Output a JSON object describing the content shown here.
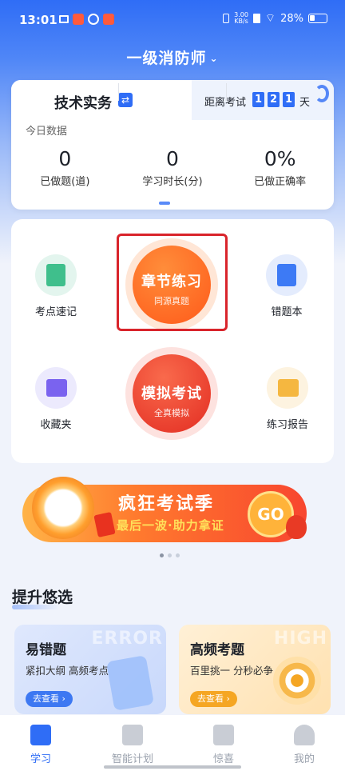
{
  "status_bar": {
    "time": "13:01",
    "net_speed": "3.00\nKB/s",
    "battery": "28%"
  },
  "header": {
    "title": "一级消防师"
  },
  "summary_card": {
    "subject": "技术实务",
    "countdown_label": "距离考试",
    "countdown_digits": [
      "1",
      "2",
      "1"
    ],
    "countdown_unit": "天",
    "today_label": "今日数据",
    "stats": [
      {
        "value": "0",
        "label": "已做题(道)"
      },
      {
        "value": "0",
        "label": "学习时长(分)"
      },
      {
        "value": "0%",
        "label": "已做正确率"
      }
    ]
  },
  "features": {
    "quick_notes": "考点速记",
    "wrong_book": "错题本",
    "favorites": "收藏夹",
    "practice_report": "练习报告",
    "chapter_practice": {
      "title": "章节练习",
      "subtitle": "同源真题"
    },
    "mock_exam": {
      "title": "模拟考试",
      "subtitle": "全真模拟"
    }
  },
  "banner": {
    "title": "疯狂考试季",
    "subtitle": "最后一波·助力拿证",
    "go": "GO"
  },
  "recommend": {
    "title": "提升悠选",
    "cards": [
      {
        "title": "易错题",
        "desc": "紧扣大纲 高频考点",
        "action": "去查看 ›",
        "ghost": "ERROR"
      },
      {
        "title": "高频考题",
        "desc": "百里挑一 分秒必争",
        "action": "去查看 ›",
        "ghost": "HIGH"
      }
    ]
  },
  "tabbar": {
    "items": [
      "学习",
      "智能计划",
      "惊喜",
      "我的"
    ]
  },
  "colors": {
    "primary": "#2f6df6",
    "chapter_orange": "#ff6a1f",
    "mock_red": "#e8392c",
    "highlight_border": "#d9242b"
  }
}
